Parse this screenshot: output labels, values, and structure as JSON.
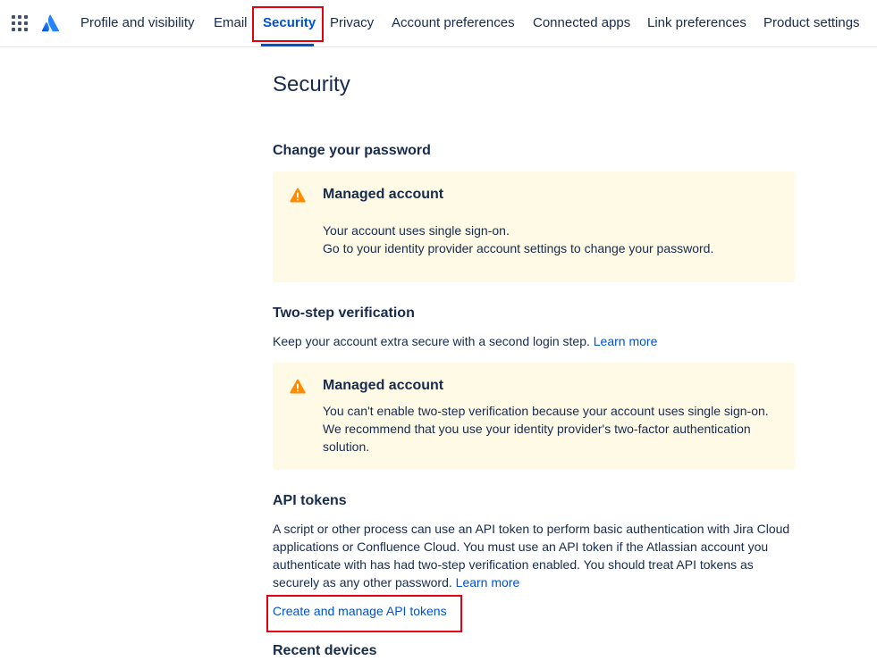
{
  "nav": {
    "items": [
      {
        "label": "Profile and visibility"
      },
      {
        "label": "Email"
      },
      {
        "label": "Security"
      },
      {
        "label": "Privacy"
      },
      {
        "label": "Account preferences"
      },
      {
        "label": "Connected apps"
      },
      {
        "label": "Link preferences"
      },
      {
        "label": "Product settings"
      }
    ],
    "active": "Security"
  },
  "page": {
    "title": "Security"
  },
  "password": {
    "heading": "Change your password",
    "notice": {
      "title": "Managed account",
      "line1": "Your account uses single sign-on.",
      "line2": "Go to your identity provider account settings to change your password."
    }
  },
  "two_step": {
    "heading": "Two-step verification",
    "description": "Keep your account extra secure with a second login step.",
    "learn_more": "Learn more",
    "notice": {
      "title": "Managed account",
      "body": "You can't enable two-step verification because your account uses single sign-on. We recommend that you use your identity provider's two-factor authentication solution."
    }
  },
  "api_tokens": {
    "heading": "API tokens",
    "description": "A script or other process can use an API token to perform basic authentication with Jira Cloud applications or Confluence Cloud. You must use an API token if the Atlassian account you authenticate with has had two-step verification enabled. You should treat API tokens as securely as any other password.",
    "learn_more": "Learn more",
    "manage_link": "Create and manage API tokens"
  },
  "devices": {
    "heading": "Recent devices"
  },
  "colors": {
    "text": "#172B4D",
    "link": "#0052CC",
    "warning_bg": "#FFFAE6",
    "warning_icon": "#FF8B00",
    "highlight": "#E3000F"
  },
  "icons": {
    "app_switcher": "grid-icon",
    "logo": "atlassian-logo-icon",
    "warning": "warning-icon"
  }
}
